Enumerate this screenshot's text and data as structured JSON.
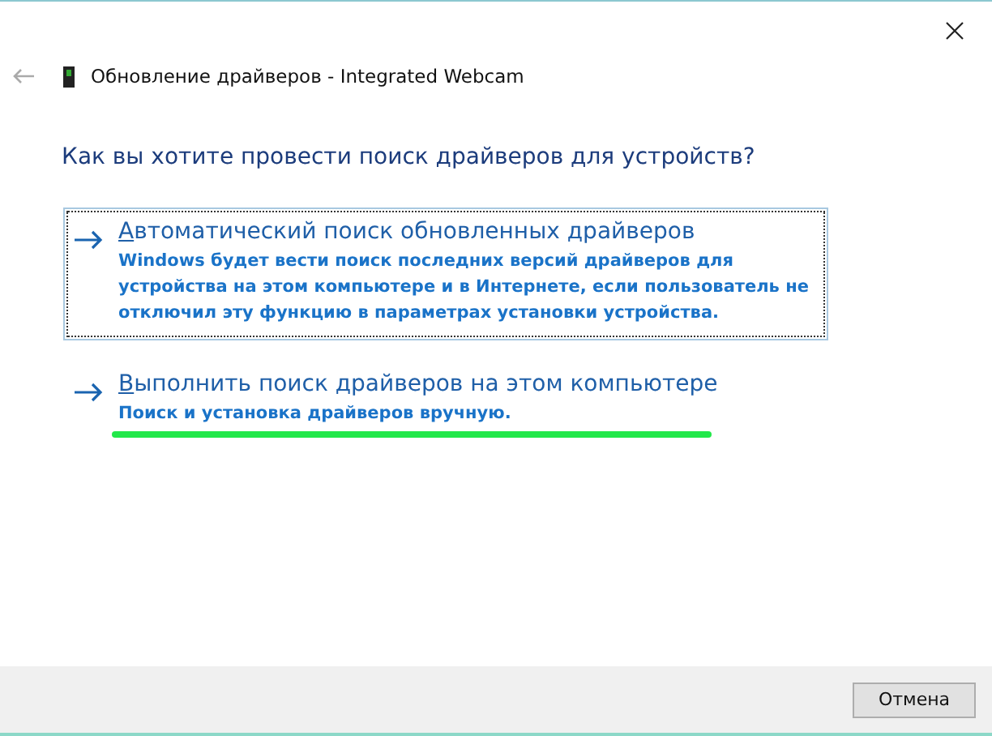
{
  "window": {
    "title": "Обновление драйверов - Integrated Webcam"
  },
  "heading": "Как вы хотите провести поиск драйверов для устройств?",
  "options": [
    {
      "title": "Автоматический поиск обновленных драйверов",
      "description": "Windows будет вести поиск последних версий драйверов для устройства на этом компьютере и в Интернете, если пользователь не отключил эту функцию в параметрах установки устройства.",
      "focused": true,
      "highlighted": false
    },
    {
      "title": "Выполнить поиск драйверов на этом компьютере",
      "description": "Поиск и установка драйверов вручную.",
      "focused": false,
      "highlighted": true
    }
  ],
  "buttons": [
    "Отмена"
  ]
}
